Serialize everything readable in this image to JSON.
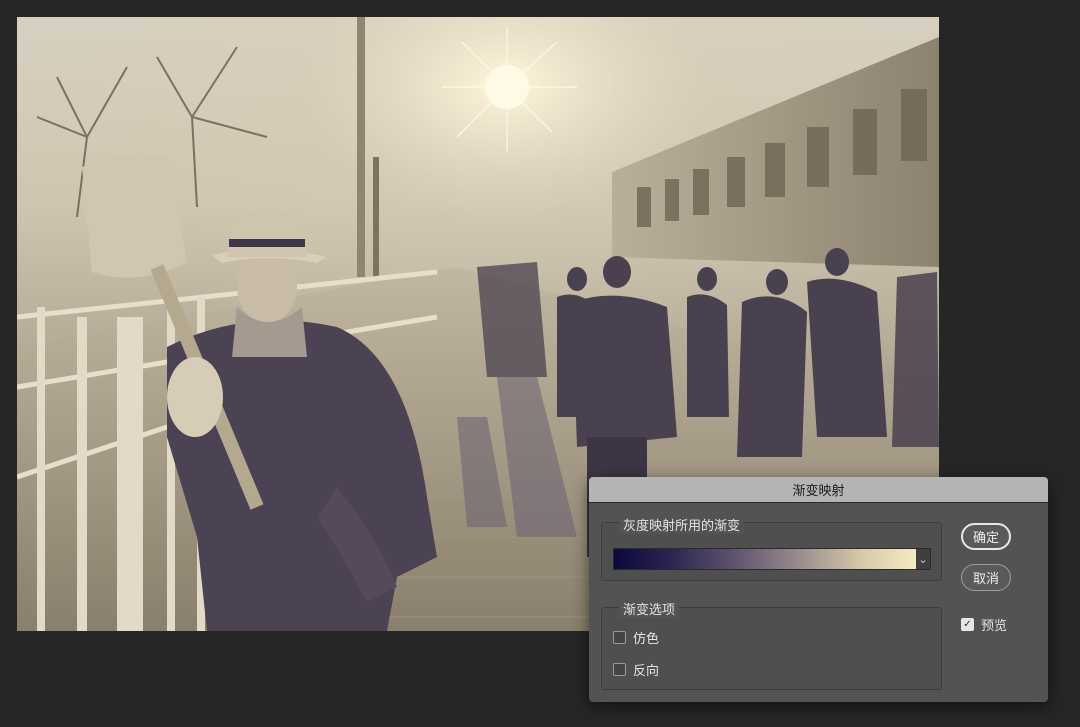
{
  "dialog": {
    "title": "渐变映射",
    "gradient_group_label": "灰度映射所用的渐变",
    "gradient_dropdown_icon": "chevron-down-icon",
    "options_group_label": "渐变选项",
    "dither_label": "仿色",
    "dither_checked": false,
    "reverse_label": "反向",
    "reverse_checked": false,
    "ok_label": "确定",
    "cancel_label": "取消",
    "preview_label": "预览",
    "preview_checked": true,
    "gradient_colors": [
      "#0b0a3c",
      "#f4ebc2"
    ]
  },
  "canvas": {
    "background_color": "#262626"
  }
}
